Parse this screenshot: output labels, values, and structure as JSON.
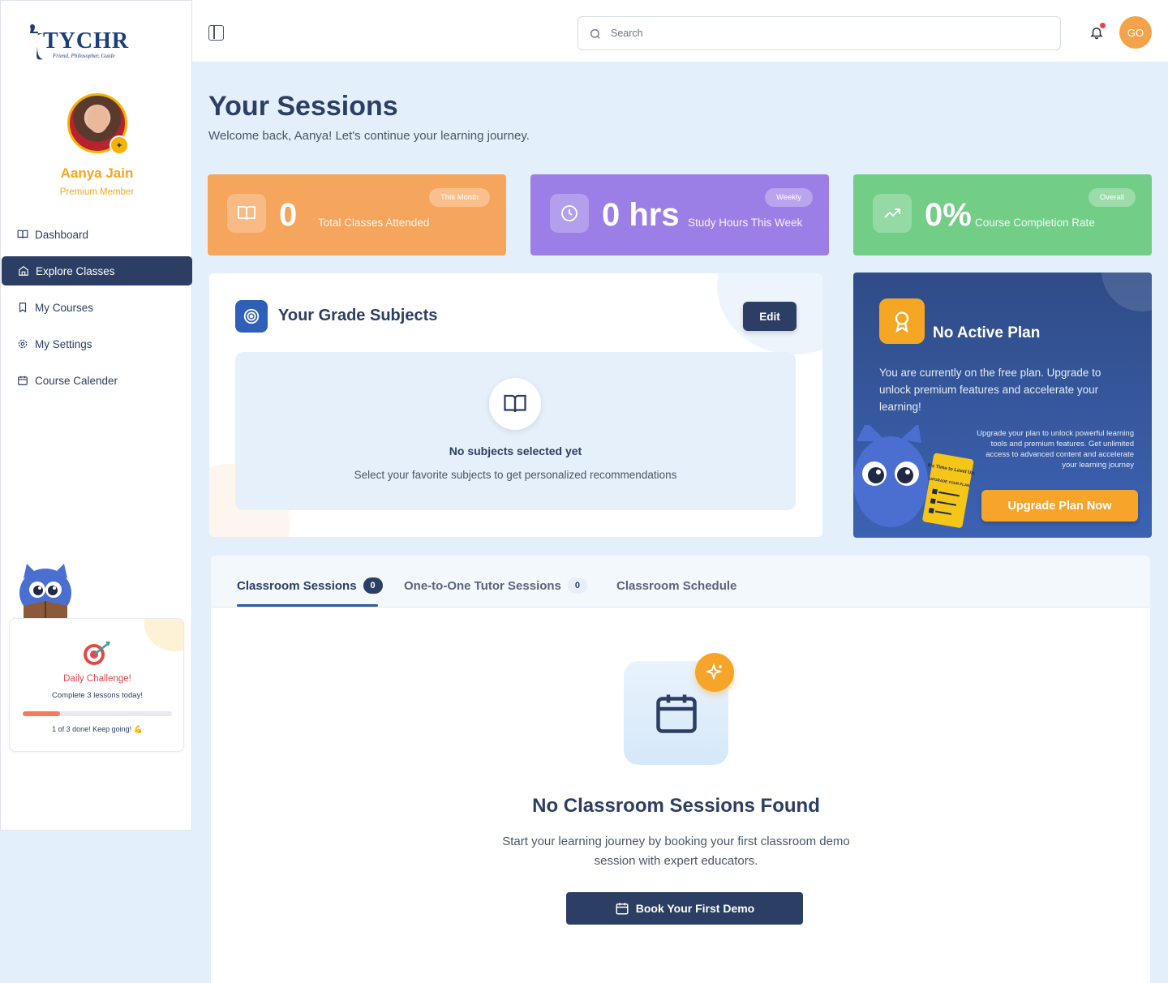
{
  "brand": {
    "name": "TYCHR",
    "tagline": "Friend, Philosopher, Guide"
  },
  "user": {
    "name": "Aanya Jain",
    "tier": "Premium Member",
    "initials": "GO"
  },
  "sidebar": {
    "items": [
      {
        "label": "Dashboard",
        "icon": "book-open-icon",
        "active": false
      },
      {
        "label": "Explore Classes",
        "icon": "home-icon",
        "active": true
      },
      {
        "label": "My Courses",
        "icon": "bookmark-icon",
        "active": false
      },
      {
        "label": "My Settings",
        "icon": "gear-icon",
        "active": false
      },
      {
        "label": "Course Calender",
        "icon": "calendar-icon",
        "active": false
      }
    ]
  },
  "challenge": {
    "title": "Daily Challenge!",
    "task": "Complete 3 lessons today!",
    "progress": 0.25,
    "footer": "1 of 3 done! Keep going! 💪"
  },
  "search": {
    "placeholder": "Search"
  },
  "page": {
    "title": "Your Sessions",
    "subtitle": "Welcome back, Aanya! Let's continue your learning journey."
  },
  "stats": [
    {
      "value": "0",
      "label": "Total Classes Attended",
      "chip": "This Month",
      "color": "#f6a55c"
    },
    {
      "value": "0 hrs",
      "label": "Study Hours This Week",
      "chip": "Weekly",
      "color": "#9b7fe6"
    },
    {
      "value": "0%",
      "label": "Course Completion Rate",
      "chip": "Overall",
      "color": "#72cd86"
    }
  ],
  "subjects": {
    "title": "Your Grade Subjects",
    "edit_label": "Edit",
    "empty_title": "No subjects selected yet",
    "empty_sub": "Select your favorite subjects to get personalized recommendations"
  },
  "plan": {
    "title": "No Active Plan",
    "desc": "You are currently on the free plan. Upgrade to unlock premium features and accelerate your learning!",
    "small": "Upgrade your plan to unlock powerful learning tools and premium features. Get unlimited access to advanced content and accelerate your learning journey",
    "button": "Upgrade Plan Now",
    "card_text": "It's Time to Level Up!",
    "card_sub": "UPGRADE YOUR PLAN"
  },
  "sessions": {
    "tabs": [
      {
        "label": "Classroom Sessions",
        "count": "0",
        "active": true
      },
      {
        "label": "One-to-One Tutor Sessions",
        "count": "0",
        "active": false
      },
      {
        "label": "Classroom Schedule",
        "count": null,
        "active": false
      }
    ],
    "empty_title": "No Classroom Sessions Found",
    "empty_desc": "Start your learning journey by booking your first classroom demo session with expert educators.",
    "button": "Book Your First Demo"
  }
}
